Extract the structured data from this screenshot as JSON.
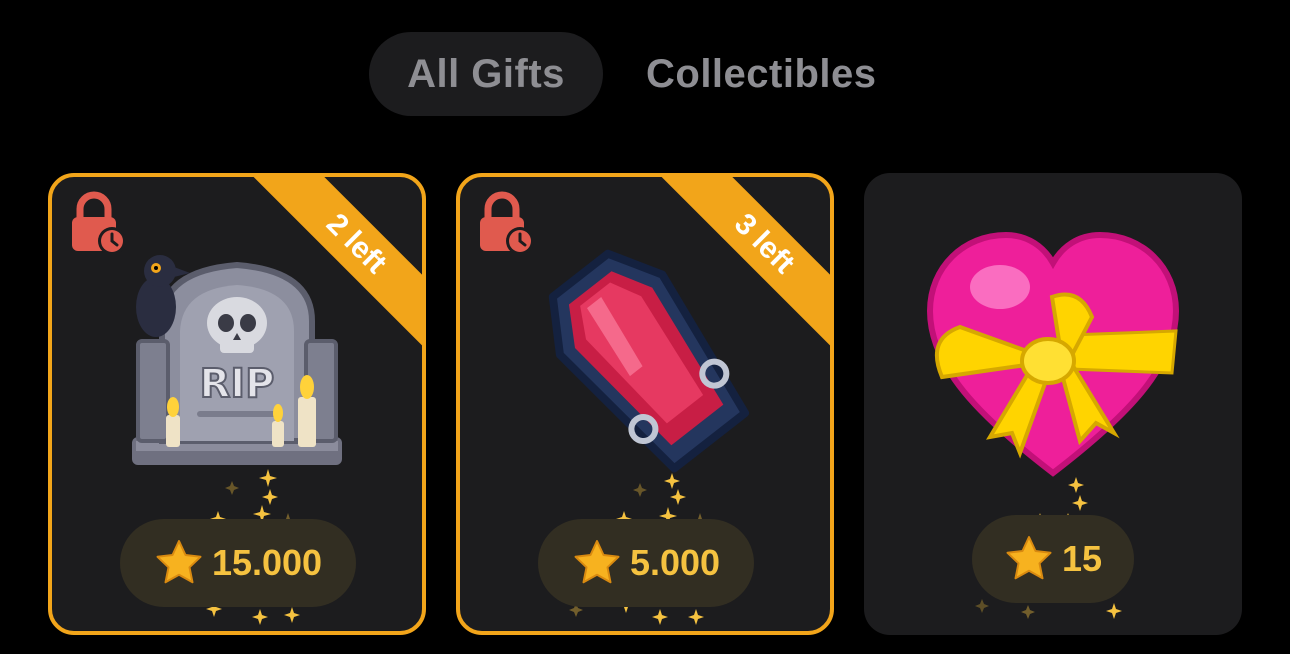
{
  "tabs": [
    {
      "label": "All Gifts",
      "active": true
    },
    {
      "label": "Collectibles",
      "active": false
    }
  ],
  "gifts": [
    {
      "name": "tombstone",
      "ribbon": "2 left",
      "locked": true,
      "price": "15.000",
      "icon": "tombstone-rip-icon"
    },
    {
      "name": "coffin",
      "ribbon": "3 left",
      "locked": true,
      "price": "5.000",
      "icon": "coffin-icon"
    },
    {
      "name": "heart-with-bow",
      "ribbon": "",
      "locked": false,
      "price": "15",
      "icon": "heart-with-ribbon-icon"
    }
  ],
  "colors": {
    "background": "#000000",
    "card": "#1c1c1e",
    "accent": "#f2a51a",
    "price_text": "#f5c240",
    "lock": "#e05a4e"
  }
}
